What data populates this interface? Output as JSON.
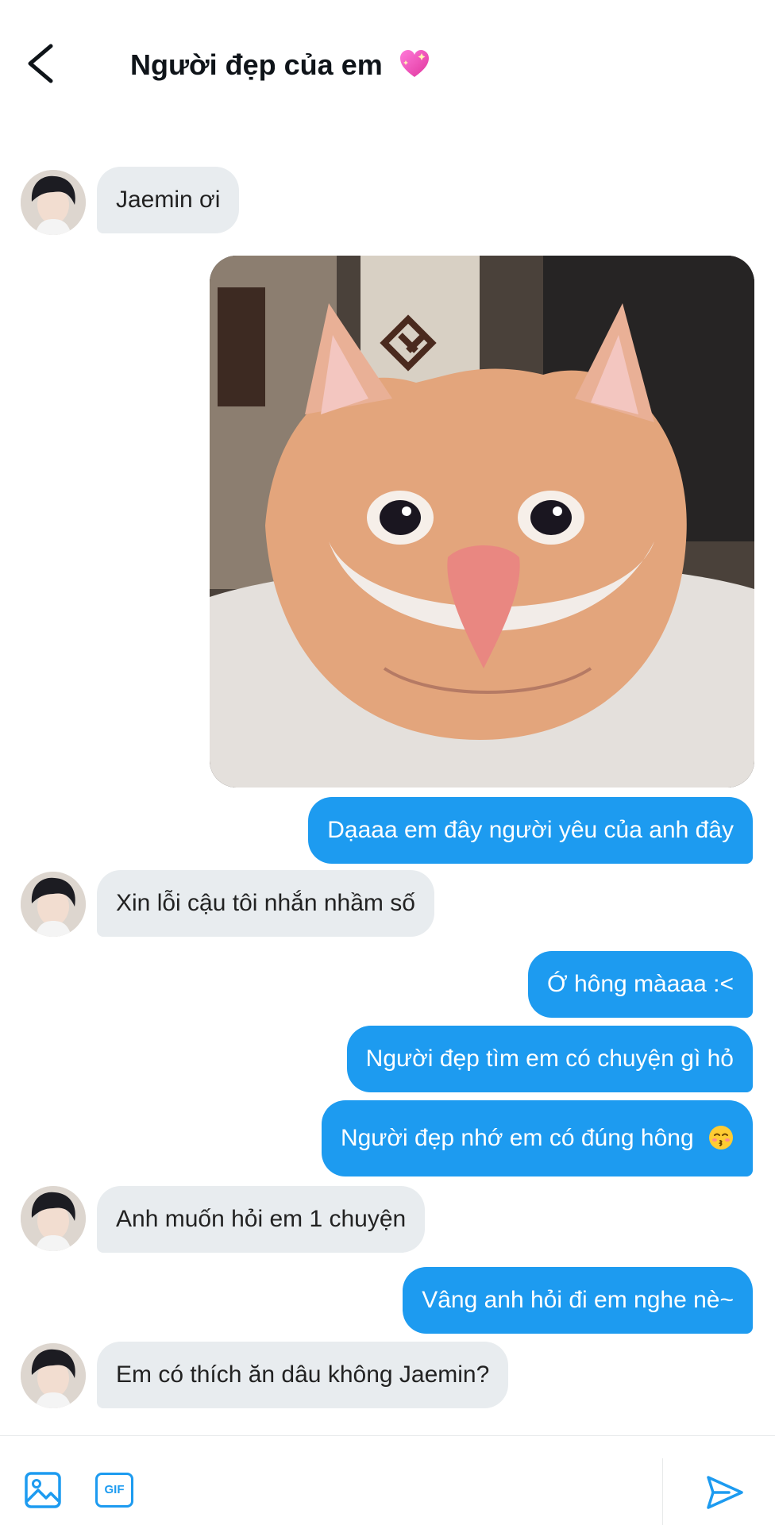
{
  "header": {
    "title": "Người đẹp của em",
    "back_icon": "chevron-left-icon",
    "heart_icon": "sparkling-heart-icon"
  },
  "messages": [
    {
      "side": "in",
      "text": "Jaemin ơi"
    },
    {
      "side": "out",
      "type": "image",
      "description_icon": "cat-photo"
    },
    {
      "side": "out",
      "text": "Dạaaa em đây người yêu của anh đây"
    },
    {
      "side": "in",
      "text": "Xin lỗi cậu tôi nhắn nhầm số"
    },
    {
      "side": "out",
      "text": "Ớ hông màaaa :<"
    },
    {
      "side": "out",
      "text": "Người đẹp tìm em có chuyện gì hỏ"
    },
    {
      "side": "out",
      "text": "Người đẹp nhớ em có đúng hông",
      "emoji": "kissing-face-icon"
    },
    {
      "side": "in",
      "text": "Anh muốn hỏi em 1 chuyện"
    },
    {
      "side": "out",
      "text": "Vâng anh hỏi đi em nghe nè~"
    },
    {
      "side": "in",
      "text": "Em có thích ăn dâu không Jaemin?"
    }
  ],
  "composer": {
    "media_icon": "image-icon",
    "gif_label": "GIF",
    "send_icon": "send-icon"
  },
  "colors": {
    "accent": "#1d9bf0",
    "incoming_bubble": "#e8ecef",
    "text": "#0f1419"
  }
}
